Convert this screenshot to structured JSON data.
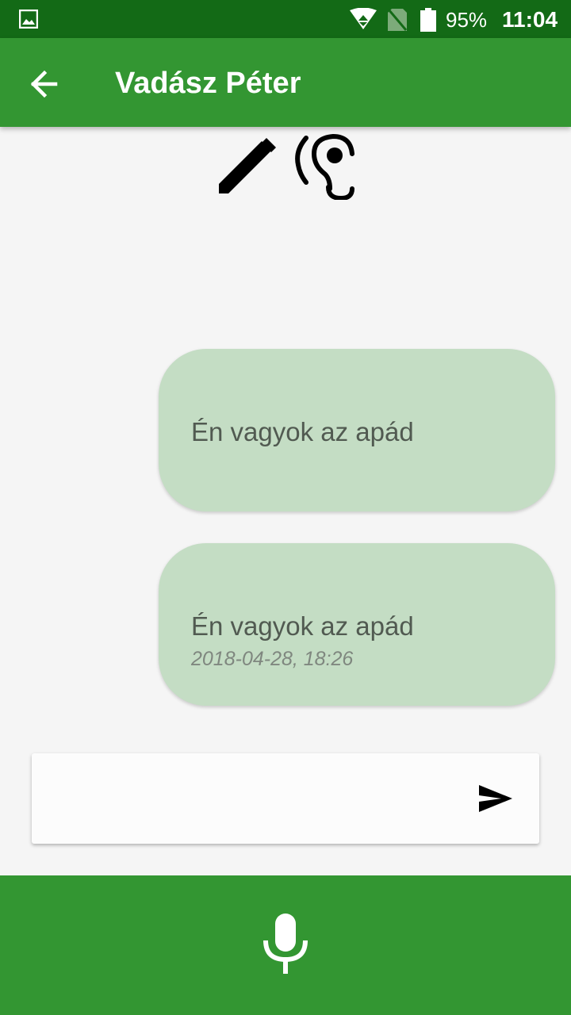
{
  "status_bar": {
    "battery_percent": "95%",
    "time": "11:04",
    "icons": [
      "gallery-icon",
      "wifi-icon",
      "no-sim-icon",
      "battery-icon"
    ]
  },
  "app_bar": {
    "title": "Vadász Péter",
    "back_icon": "arrow-left-icon"
  },
  "mode_icons": [
    "pencil-icon",
    "ear-icon"
  ],
  "messages": [
    {
      "text": "Én vagyok az apád",
      "time": ""
    },
    {
      "text": "Én vagyok az apád",
      "time": "2018-04-28, 18:26"
    }
  ],
  "composer": {
    "value": "",
    "placeholder": "",
    "send_icon": "send-icon"
  },
  "bottom_bar": {
    "mic_icon": "microphone-icon"
  },
  "colors": {
    "status_bar": "#136a16",
    "primary": "#339632",
    "bubble": "#c4ddc4",
    "background": "#f5f5f5"
  }
}
